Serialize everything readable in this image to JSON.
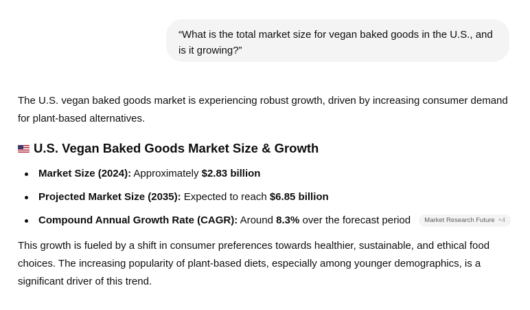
{
  "user_message": "“What is the total market size for vegan baked goods in the U.S., and is it growing?”",
  "assistant": {
    "intro": "The U.S. vegan baked goods market is experiencing robust growth, driven by increasing consumer demand for plant-based alternatives.",
    "heading": "U.S. Vegan Baked Goods Market Size & Growth",
    "heading_icon": "us-flag-icon",
    "bullets": [
      {
        "label": "Market Size (2024):",
        "text_before": " Approximately ",
        "value": "$2.83 billion",
        "text_after": ""
      },
      {
        "label": "Projected Market Size (2035):",
        "text_before": " Expected to reach ",
        "value": "$6.85 billion",
        "text_after": ""
      },
      {
        "label": "Compound Annual Growth Rate (CAGR):",
        "text_before": " Around ",
        "value": "8.3%",
        "text_after": " over the forecast period"
      }
    ],
    "source": {
      "name": "Market Research Future",
      "more": "+4"
    },
    "conclusion": "This growth is fueled by a shift in consumer preferences towards healthier, sustainable, and ethical food choices. The increasing popularity of plant-based diets, especially among younger demographics, is a significant driver of this trend."
  },
  "colors": {
    "text": "#0d0d0d",
    "bubble_bg": "#f4f4f4",
    "pill_text": "#5d5d5d"
  }
}
